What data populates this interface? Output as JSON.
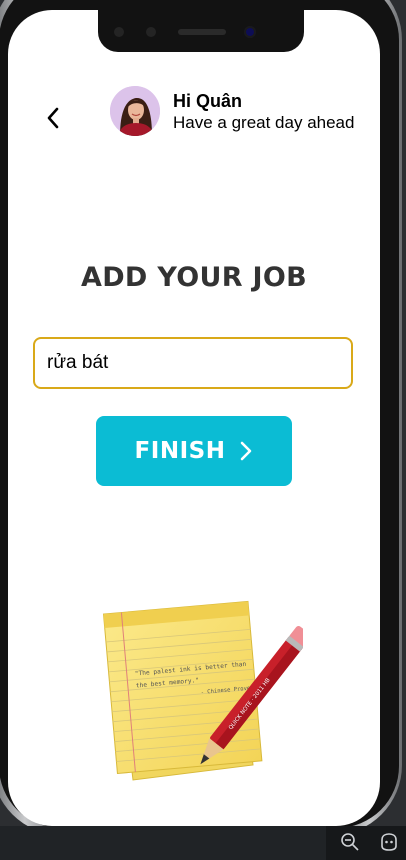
{
  "header": {
    "greeting_name": "Hi Quân",
    "greeting_message": "Have a great day ahead"
  },
  "main": {
    "title": "ADD YOUR JOB",
    "job_input_value": "rửa bát",
    "finish_label": "FINISH"
  },
  "illustration": {
    "note_quote": "\"The palest ink is better than the best memory.\"",
    "note_attribution": "- Chinese Proverb",
    "pencil_text": "QUICK NOTE",
    "pencil_text_2": "2011 HB"
  },
  "colors": {
    "accent": "#0bbcd4",
    "input_border": "#d9a919",
    "title": "#333333"
  },
  "icons": {
    "back": "chevron-left-icon",
    "finish": "chevron-right-icon",
    "taskbar_zoom": "zoom-out-icon",
    "taskbar_copilot": "copilot-icon"
  }
}
